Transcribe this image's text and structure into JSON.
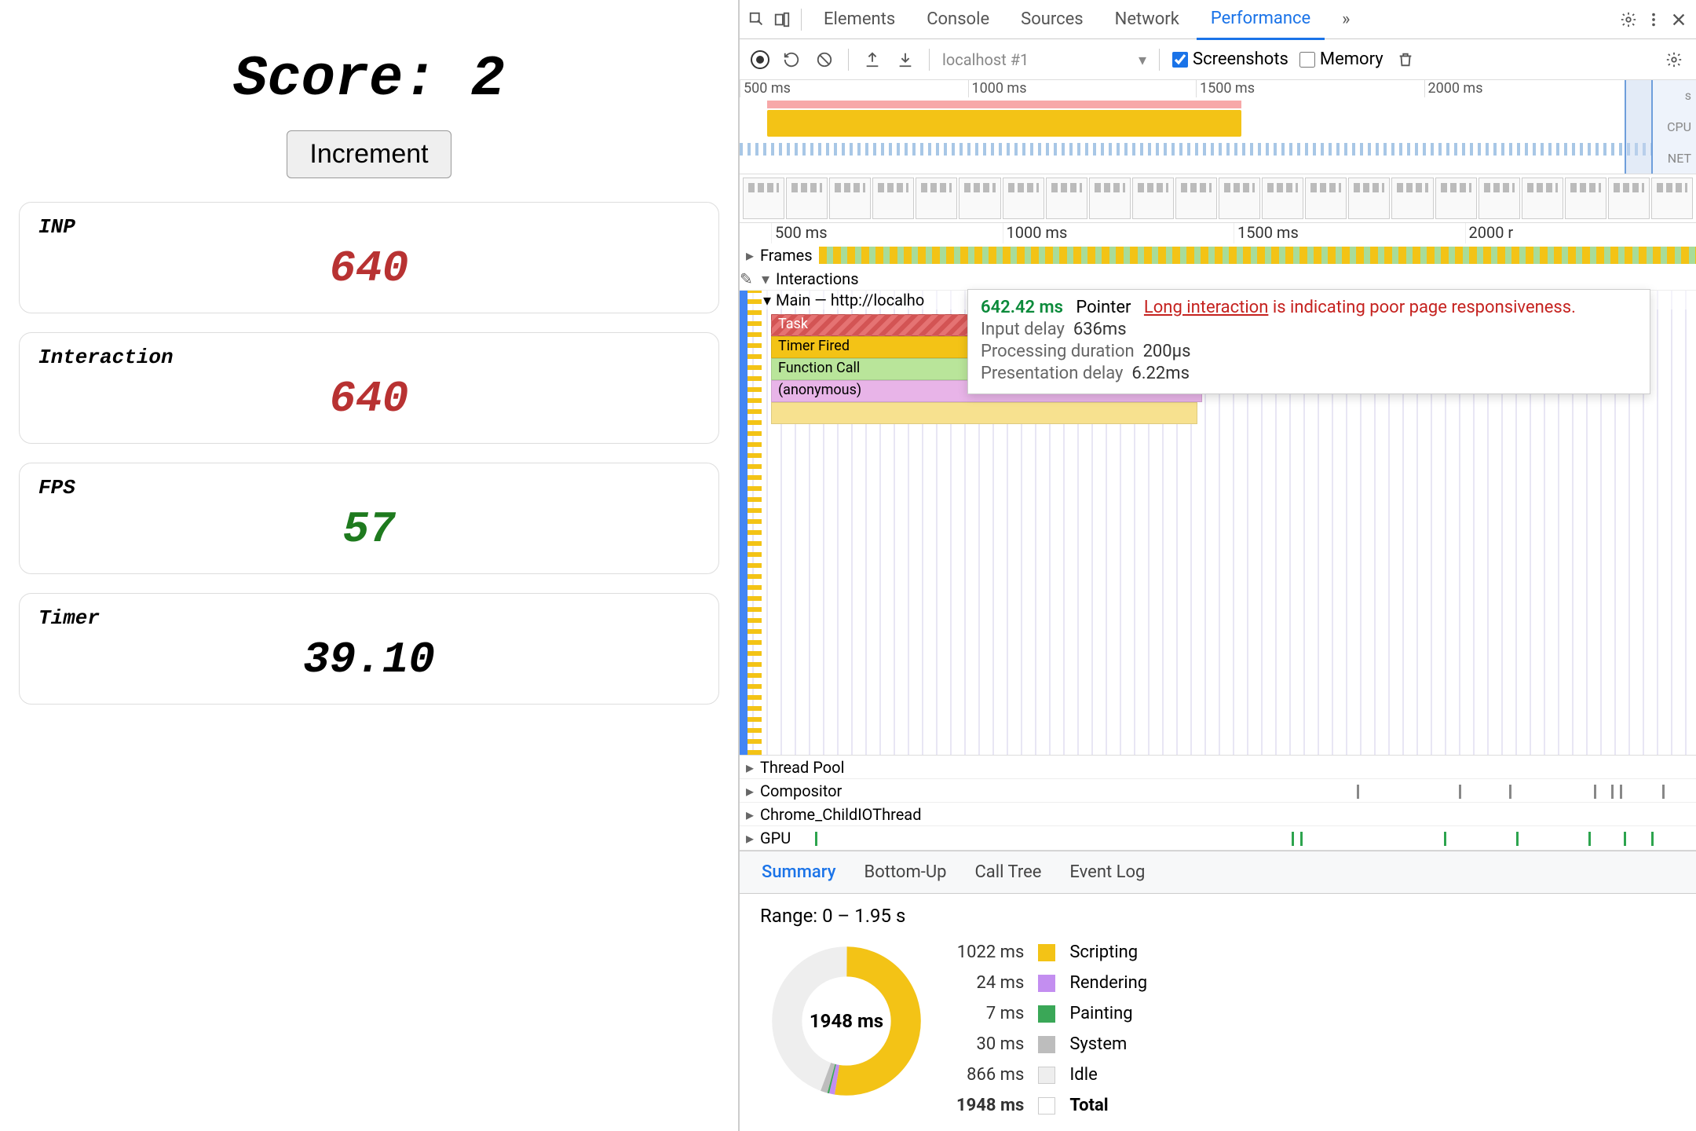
{
  "app": {
    "score_prefix": "Score: ",
    "score_value": "2",
    "increment_label": "Increment",
    "cards": {
      "inp": {
        "label": "INP",
        "value": "640"
      },
      "interaction": {
        "label": "Interaction",
        "value": "640"
      },
      "fps": {
        "label": "FPS",
        "value": "57"
      },
      "timer": {
        "label": "Timer",
        "value": "39.10"
      }
    }
  },
  "devtools": {
    "tabs": {
      "elements": "Elements",
      "console": "Console",
      "sources": "Sources",
      "network": "Network",
      "performance": "Performance",
      "more": "»"
    }
  },
  "perf_toolbar": {
    "profile_select": "localhost #1",
    "screenshots_label": "Screenshots",
    "memory_label": "Memory",
    "screenshots_checked": true,
    "memory_checked": false
  },
  "overview": {
    "ticks": [
      "500 ms",
      "1000 ms",
      "1500 ms",
      "2000 ms"
    ],
    "cpu_label": "CPU",
    "net_label": "NET",
    "unit_label": "s"
  },
  "timeline": {
    "ticks": [
      "500 ms",
      "1000 ms",
      "1500 ms",
      "2000 r"
    ],
    "frames_label": "Frames",
    "interactions_label": "Interactions",
    "main_label": "Main — http://localho",
    "flame": {
      "task": "Task",
      "timer": "Timer Fired",
      "fcall": "Function Call",
      "anon": "(anonymous)"
    },
    "threads": {
      "pool": "Thread Pool",
      "compositor": "Compositor",
      "childio": "Chrome_ChildIOThread",
      "gpu": "GPU"
    }
  },
  "tooltip": {
    "ms": "642.42 ms",
    "kind": "Pointer",
    "link": "Long interaction",
    "tail": " is indicating poor page responsiveness.",
    "rows": [
      {
        "k": "Input delay",
        "v": "636ms"
      },
      {
        "k": "Processing duration",
        "v": "200µs"
      },
      {
        "k": "Presentation delay",
        "v": "6.22ms"
      }
    ]
  },
  "summary": {
    "tabs": {
      "summary": "Summary",
      "bottomup": "Bottom-Up",
      "calltree": "Call Tree",
      "eventlog": "Event Log"
    },
    "range": "Range: 0 – 1.95 s",
    "center": "1948 ms",
    "legend": [
      {
        "ms": "1022 ms",
        "name": "Scripting",
        "cls": "scripting"
      },
      {
        "ms": "24 ms",
        "name": "Rendering",
        "cls": "rendering"
      },
      {
        "ms": "7 ms",
        "name": "Painting",
        "cls": "painting"
      },
      {
        "ms": "30 ms",
        "name": "System",
        "cls": "system"
      },
      {
        "ms": "866 ms",
        "name": "Idle",
        "cls": "idle"
      },
      {
        "ms": "1948 ms",
        "name": "Total",
        "cls": "total"
      }
    ]
  },
  "chart_data": {
    "type": "pie",
    "title": "Performance summary",
    "series": [
      {
        "name": "Scripting",
        "value": 1022,
        "color": "#f3c316"
      },
      {
        "name": "Rendering",
        "value": 24,
        "color": "#c38ef0"
      },
      {
        "name": "Painting",
        "value": 7,
        "color": "#3aa757"
      },
      {
        "name": "System",
        "value": 30,
        "color": "#bdbdbd"
      },
      {
        "name": "Idle",
        "value": 866,
        "color": "#eeeeee"
      }
    ],
    "total_ms": 1948,
    "range_seconds": [
      0,
      1.95
    ]
  }
}
